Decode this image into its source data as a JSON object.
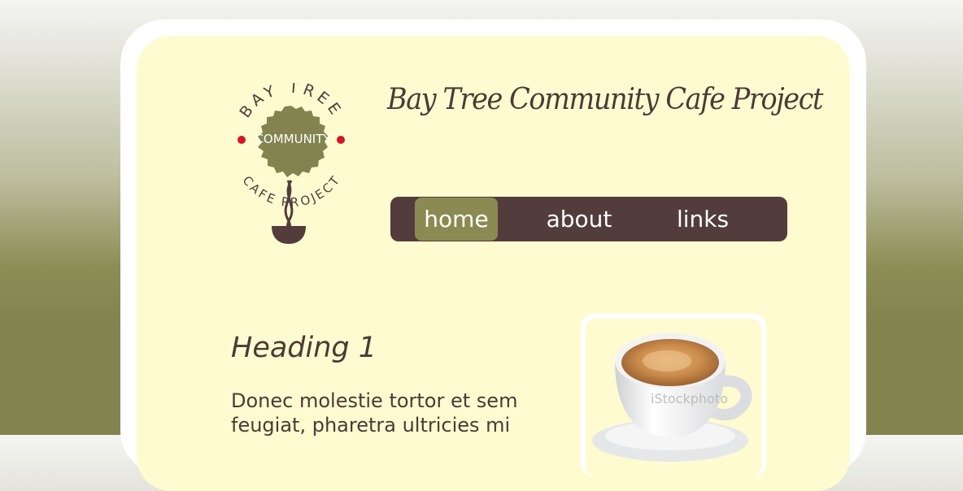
{
  "logo": {
    "top_text": "BAY TREE",
    "center_text": "COMMUNITY",
    "bottom_text": "CAFE PROJECT"
  },
  "site": {
    "title": "Bay Tree Community Cafe Project"
  },
  "nav": {
    "items": [
      {
        "label": "home",
        "active": true
      },
      {
        "label": "about",
        "active": false
      },
      {
        "label": "links",
        "active": false
      }
    ]
  },
  "content": {
    "heading": "Heading 1",
    "paragraph": "Donec molestie tortor et sem feugiat, pharetra ultricies mi"
  },
  "photo": {
    "watermark": "iStockphoto"
  },
  "colors": {
    "cream": "#fffbd0",
    "olive": "#838350",
    "nav_bg": "#533c3c",
    "active_tab": "#8a8a52",
    "text": "#4b3a35"
  }
}
